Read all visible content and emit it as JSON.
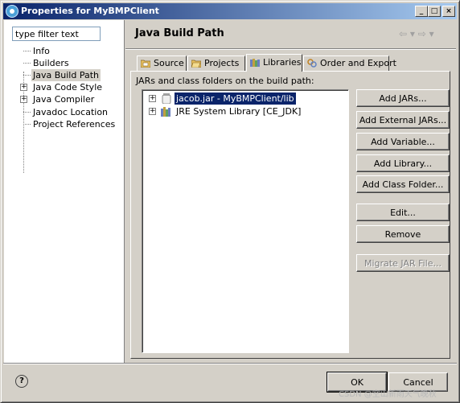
{
  "window": {
    "title": "Properties for MyBMPClient"
  },
  "filter": {
    "placeholder": "type filter text",
    "value": "type filter text"
  },
  "nav_tree": [
    {
      "label": "Info",
      "expandable": false
    },
    {
      "label": "Builders",
      "expandable": false
    },
    {
      "label": "Java Build Path",
      "expandable": false,
      "selected": true
    },
    {
      "label": "Java Code Style",
      "expandable": true
    },
    {
      "label": "Java Compiler",
      "expandable": true
    },
    {
      "label": "Javadoc Location",
      "expandable": false
    },
    {
      "label": "Project References",
      "expandable": false
    }
  ],
  "page": {
    "title": "Java Build Path"
  },
  "tabs": [
    {
      "label": "Source",
      "icon": "source-folder-icon"
    },
    {
      "label": "Projects",
      "icon": "projects-icon"
    },
    {
      "label": "Libraries",
      "icon": "libraries-icon",
      "active": true
    },
    {
      "label": "Order and Export",
      "icon": "order-export-icon"
    }
  ],
  "libraries": {
    "heading": "JARs and class folders on the build path:",
    "entries": [
      {
        "label": "jacob.jar - MyBMPClient/lib",
        "icon": "jar-icon",
        "selected": true
      },
      {
        "label": "JRE System Library [CE_JDK]",
        "icon": "library-icon"
      }
    ]
  },
  "buttons": {
    "add_jars": "Add JARs...",
    "add_external_jars": "Add External JARs...",
    "add_variable": "Add Variable...",
    "add_library": "Add Library...",
    "add_class_folder": "Add Class Folder...",
    "edit": "Edit...",
    "remove": "Remove",
    "migrate_jar": "Migrate JAR File..."
  },
  "dialog": {
    "help": "?",
    "ok": "OK",
    "cancel": "Cancel"
  },
  "watermark": "CSDN @空山新雨天气晚秋",
  "colors": {
    "dialog_bg": "#d4d0c8",
    "title_bar": "#0a246a",
    "selection": "#0a246a"
  }
}
